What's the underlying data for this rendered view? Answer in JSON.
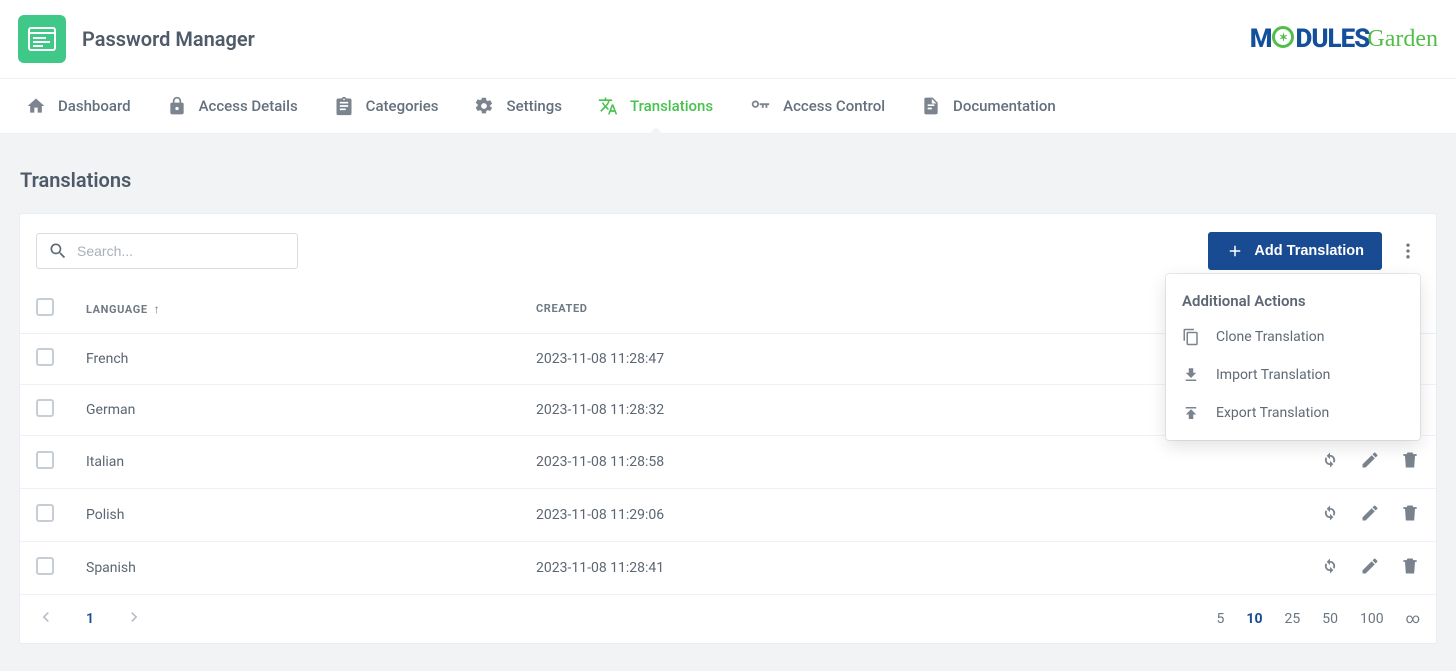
{
  "app": {
    "title": "Password Manager"
  },
  "brand": {
    "modules": "M",
    "odules_rest": "DULES",
    "garden": "Garden"
  },
  "nav": {
    "dashboard": "Dashboard",
    "access_details": "Access Details",
    "categories": "Categories",
    "settings": "Settings",
    "translations": "Translations",
    "access_control": "Access Control",
    "documentation": "Documentation"
  },
  "page": {
    "title": "Translations"
  },
  "search": {
    "placeholder": "Search..."
  },
  "buttons": {
    "add": "Add Translation"
  },
  "dropdown": {
    "title": "Additional Actions",
    "clone": "Clone Translation",
    "import": "Import Translation",
    "export": "Export Translation"
  },
  "table": {
    "col_language": "Language",
    "col_created": "Created",
    "rows": [
      {
        "language": "French",
        "created": "2023-11-08 11:28:47",
        "show_actions": false
      },
      {
        "language": "German",
        "created": "2023-11-08 11:28:32",
        "show_actions": false
      },
      {
        "language": "Italian",
        "created": "2023-11-08 11:28:58",
        "show_actions": true
      },
      {
        "language": "Polish",
        "created": "2023-11-08 11:29:06",
        "show_actions": true
      },
      {
        "language": "Spanish",
        "created": "2023-11-08 11:28:41",
        "show_actions": true
      }
    ]
  },
  "pagination": {
    "current": "1",
    "sizes": [
      "5",
      "10",
      "25",
      "50",
      "100",
      "∞"
    ],
    "active_index": 1
  }
}
